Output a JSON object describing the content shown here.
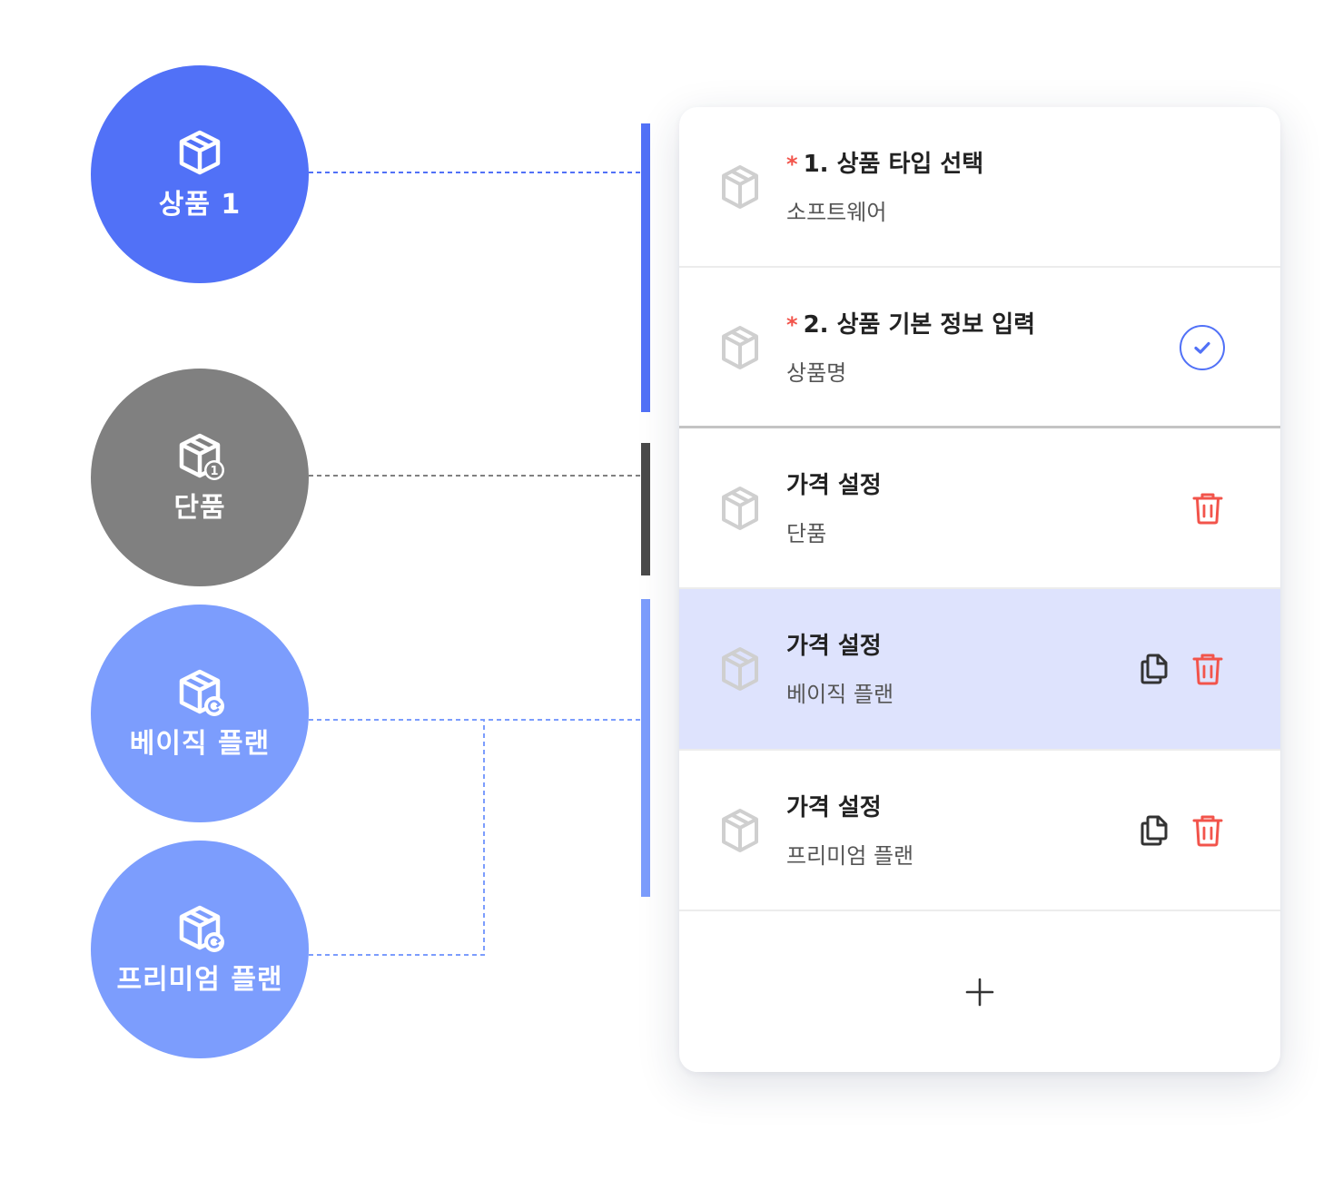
{
  "nodes": [
    {
      "label": "상품 1",
      "icon": "box-icon",
      "color": "#5171f7"
    },
    {
      "label": "단품",
      "icon": "box-single-icon",
      "color": "#808080"
    },
    {
      "label": "베이직 플랜",
      "icon": "box-refresh-icon",
      "color": "#7c9dfd"
    },
    {
      "label": "프리미엄 플랜",
      "icon": "box-refresh-icon",
      "color": "#7c9dfd"
    }
  ],
  "single_badge": "1",
  "panel": {
    "rows": [
      {
        "required_mark": "*",
        "title": "1. 상품 타입 선택",
        "sub": "소프트웨어"
      },
      {
        "required_mark": "*",
        "title": "2. 상품 기본 정보 입력",
        "sub": "상품명"
      },
      {
        "title": "가격 설정",
        "sub": "단품"
      },
      {
        "title": "가격 설정",
        "sub": "베이직 플랜"
      },
      {
        "title": "가격 설정",
        "sub": "프리미엄 플랜"
      }
    ],
    "add_icon": "plus-icon"
  },
  "colors": {
    "primary": "#5171f7",
    "secondary": "#7c9dfd",
    "gray": "#808080",
    "danger": "#f2544b",
    "highlight_row": "#dee3fd"
  }
}
